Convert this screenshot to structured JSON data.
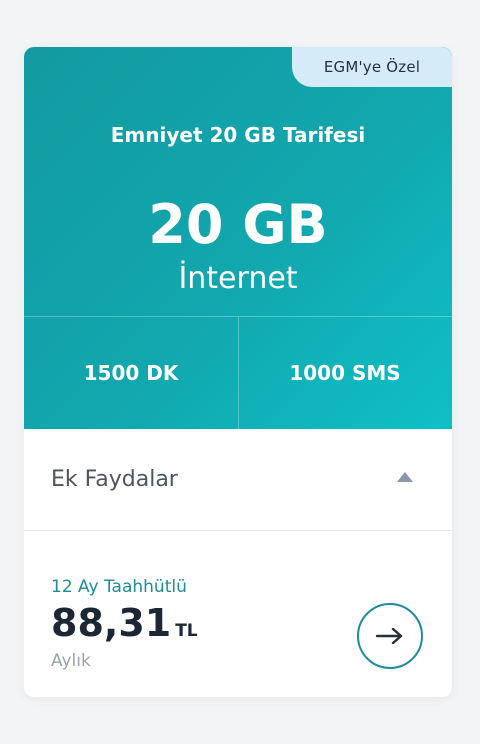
{
  "badge": {
    "label": "EGM'ye Özel"
  },
  "plan": {
    "title": "Emniyet 20 GB Tarifesi",
    "data_amount": "20 GB",
    "data_label": "İnternet",
    "minutes": "1500 DK",
    "sms": "1000 SMS"
  },
  "benefits": {
    "label": "Ek Faydalar",
    "icon": "caret-up-icon",
    "expanded": true
  },
  "pricing": {
    "commitment": "12 Ay Taahhütlü",
    "amount": "88,31",
    "currency": "TL",
    "period": "Aylık"
  },
  "action": {
    "icon": "arrow-right-icon"
  },
  "colors": {
    "accent": "#1f8c98",
    "hero_start": "#139aa1",
    "hero_end": "#0ec0c6",
    "badge_bg": "#d5ebf7"
  }
}
